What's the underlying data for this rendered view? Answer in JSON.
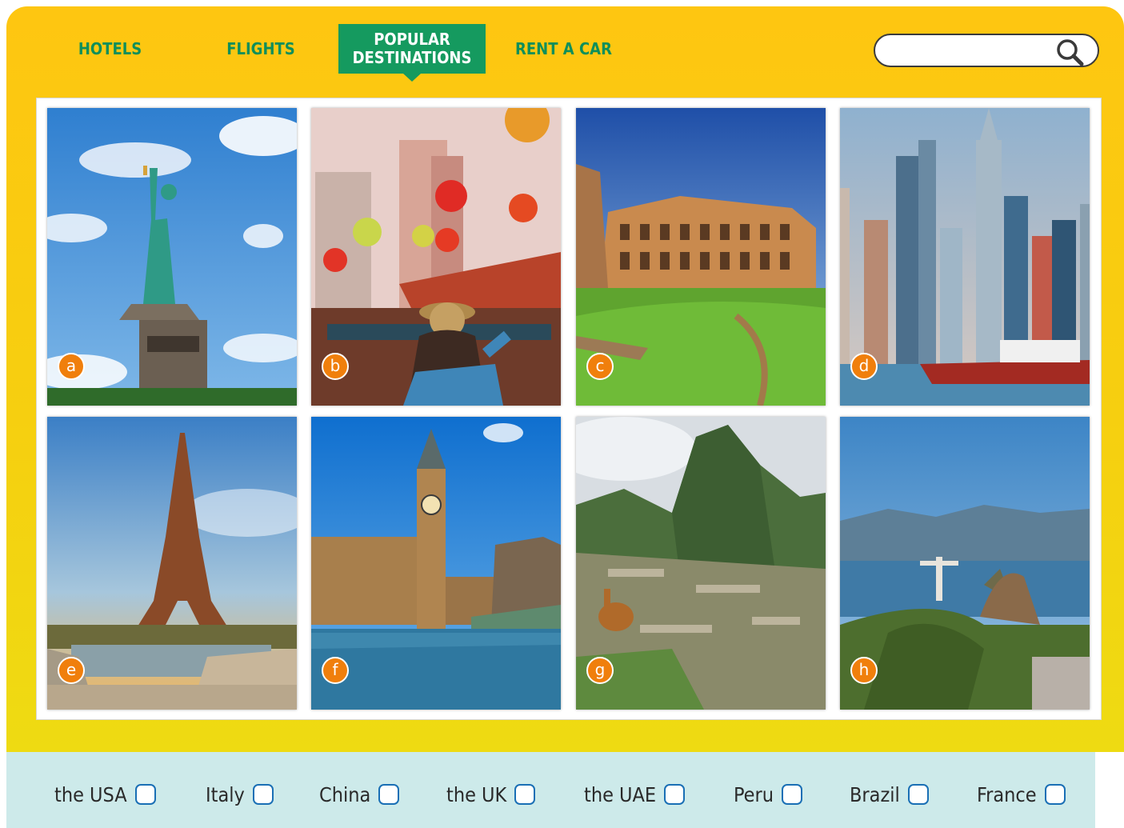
{
  "nav": {
    "tabs": [
      {
        "label": "HOTELS"
      },
      {
        "label": "FLIGHTS"
      },
      {
        "label": "POPULAR DESTINATIONS",
        "active": true
      },
      {
        "label": "RENT A CAR"
      }
    ],
    "search": {
      "value": "",
      "icon": "search-icon"
    }
  },
  "photos": [
    {
      "badge": "a",
      "scene": "statue-of-liberty"
    },
    {
      "badge": "b",
      "scene": "chinese-temple-with-lanterns"
    },
    {
      "badge": "c",
      "scene": "colosseum"
    },
    {
      "badge": "d",
      "scene": "dubai-marina-skyline"
    },
    {
      "badge": "e",
      "scene": "eiffel-tower"
    },
    {
      "badge": "f",
      "scene": "big-ben"
    },
    {
      "badge": "g",
      "scene": "machu-picchu"
    },
    {
      "badge": "h",
      "scene": "christ-the-redeemer"
    }
  ],
  "countries": [
    {
      "label": "the USA"
    },
    {
      "label": "Italy"
    },
    {
      "label": "China"
    },
    {
      "label": "the UK"
    },
    {
      "label": "the UAE"
    },
    {
      "label": "Peru"
    },
    {
      "label": "Brazil"
    },
    {
      "label": "France"
    }
  ],
  "colors": {
    "frame": "#fec611",
    "tab_text": "#0e8f5a",
    "active_tab": "#159a5f",
    "badge": "#f07f0c",
    "bottom_bar": "#cdeaea",
    "checkbox_border": "#1a6fb5"
  }
}
